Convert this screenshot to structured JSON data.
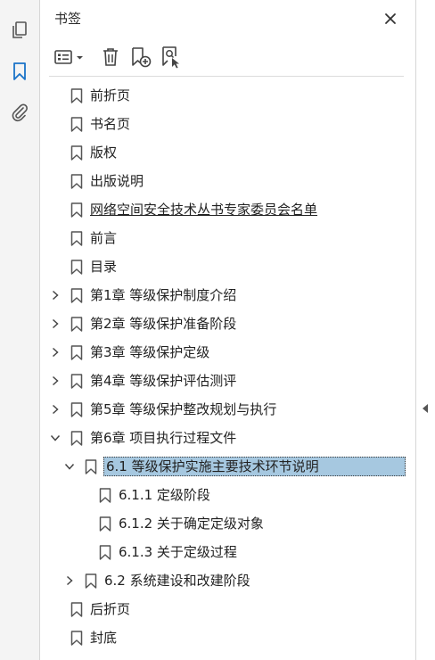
{
  "panel": {
    "title": "书签"
  },
  "rail": {
    "pages_icon": "pages-icon",
    "bookmarks_icon": "bookmark-icon",
    "attachments_icon": "paperclip-icon"
  },
  "toolbar": {
    "options_icon": "options-menu-icon",
    "delete_icon": "trash-icon",
    "new_bookmark_icon": "new-bookmark-icon",
    "find_bookmark_icon": "find-current-bookmark-icon"
  },
  "colors": {
    "accent": "#1a73c8",
    "selection": "#a6c8e0",
    "icon_gray": "#555555"
  },
  "bookmarks": [
    {
      "label": "前折页"
    },
    {
      "label": "书名页"
    },
    {
      "label": "版权"
    },
    {
      "label": "出版说明"
    },
    {
      "label": "网络空间安全技术丛书专家委员会名单"
    },
    {
      "label": "前言"
    },
    {
      "label": "目录"
    },
    {
      "label": "第1章 等级保护制度介绍"
    },
    {
      "label": "第2章 等级保护准备阶段"
    },
    {
      "label": "第3章 等级保护定级"
    },
    {
      "label": "第4章 等级保护评估测评"
    },
    {
      "label": "第5章 等级保护整改规划与执行"
    },
    {
      "label": "第6章 项目执行过程文件"
    },
    {
      "label": "6.1 等级保护实施主要技术环节说明"
    },
    {
      "label": "6.1.1 定级阶段"
    },
    {
      "label": "6.1.2 关于确定定级对象"
    },
    {
      "label": "6.1.3 关于定级过程"
    },
    {
      "label": "6.2 系统建设和改建阶段"
    },
    {
      "label": "后折页"
    },
    {
      "label": "封底"
    }
  ]
}
